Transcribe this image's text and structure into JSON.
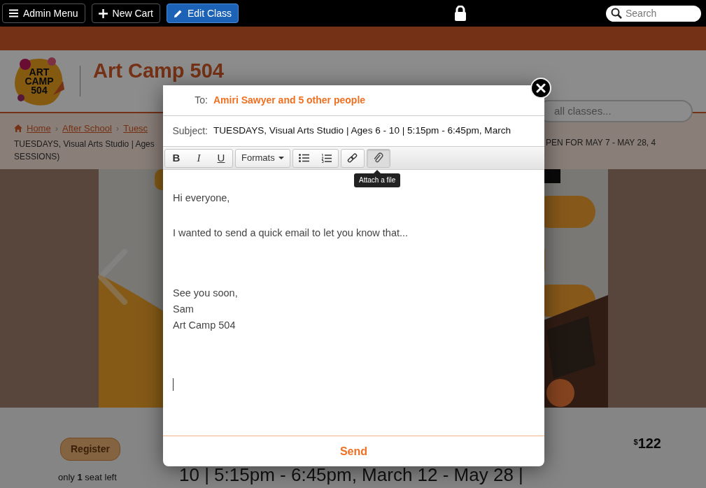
{
  "top_bar": {
    "buttons": [
      {
        "label": "Admin Menu",
        "primary": false
      },
      {
        "label": "New Cart",
        "primary": false
      },
      {
        "label": "Edit Class",
        "primary": true
      }
    ],
    "search": {
      "placeholder": "Search"
    }
  },
  "site_header": {
    "logo_lines": [
      "ART",
      "CAMP",
      "504"
    ],
    "title": "Art Camp 504",
    "search": {
      "placeholder": "all classes..."
    }
  },
  "breadcrumb": {
    "links": [
      {
        "label": "Home"
      },
      {
        "separator": "›",
        "label": "After School"
      },
      {
        "separator": "›",
        "label": "Tuesc"
      }
    ],
    "title_left": "TUESDAYS, Visual Arts Studio | Ages",
    "title_right": "PEN FOR MAY 7 - MAY 28, 4",
    "title_end": "SESSIONS)"
  },
  "listing": {
    "register": "Register",
    "price_currency": "$",
    "price": "122",
    "seats": "only **1** seat left",
    "heading": "10 | 5:15pm - 6:45pm, March 12 - May 28 |"
  },
  "email_dialog": {
    "to_label": "To:",
    "to": "Amiri Sawyer and 5 other people",
    "subject_label": "Subject:",
    "subject": "TUESDAYS, Visual Arts Studio | Ages 6 - 10 | 5:15pm - 6:45pm, March",
    "toolbar": [
      {
        "buttons": [
          {
            "kind": "bold",
            "label": "B",
            "hovered": false
          },
          {
            "kind": "italic",
            "label": "I",
            "hovered": false
          },
          {
            "kind": "underline",
            "label": "U",
            "hovered": false
          }
        ]
      },
      {
        "buttons": [
          {
            "kind": "dropdown",
            "label": "Formats",
            "hovered": false
          }
        ]
      },
      {
        "buttons": [
          {
            "kind": "bullets",
            "hovered": false
          },
          {
            "kind": "numbers",
            "hovered": false
          }
        ]
      },
      {
        "buttons": [
          {
            "kind": "link",
            "hovered": false
          }
        ]
      },
      {
        "buttons": [
          {
            "kind": "attach",
            "hovered": true
          }
        ]
      }
    ],
    "tooltip": "Attach a file",
    "paragraphs": [
      {
        "lines": [
          "Hi everyone,"
        ]
      },
      {
        "lines": [
          "I wanted to send a quick email to let you know that..."
        ]
      },
      {
        "lines": [
          "See you soon,",
          "Sam",
          "Art Camp 504"
        ]
      }
    ],
    "send": "Send"
  }
}
